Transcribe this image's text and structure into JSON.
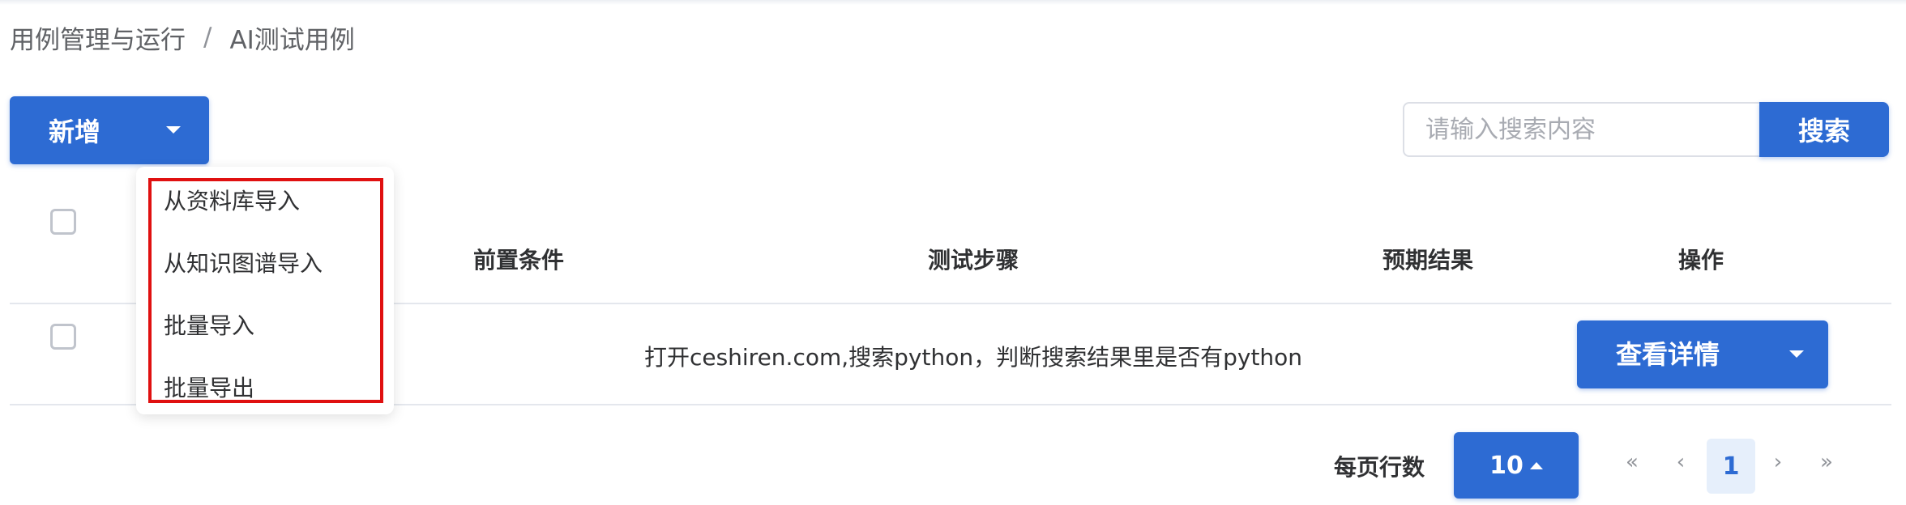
{
  "breadcrumb": {
    "parent": "用例管理与运行",
    "separator": "/",
    "current": "AI测试用例"
  },
  "toolbar": {
    "add_label": "新增"
  },
  "search": {
    "placeholder": "请输入搜索内容",
    "button_label": "搜索"
  },
  "table": {
    "columns": [
      "前置条件",
      "测试步骤",
      "预期结果",
      "操作"
    ],
    "rows": [
      {
        "steps": "打开ceshiren.com,搜索python，判断搜索结果里是否有python",
        "action_label": "查看详情"
      }
    ]
  },
  "add_menu": {
    "items": [
      "从资料库导入",
      "从知识图谱导入",
      "批量导入",
      "批量导出"
    ]
  },
  "pagination": {
    "rows_per_page_label": "每页行数",
    "rows_per_page": "10",
    "current_page": "1"
  },
  "colors": {
    "primary": "#2d6bd3",
    "highlight_box": "#e01010"
  }
}
